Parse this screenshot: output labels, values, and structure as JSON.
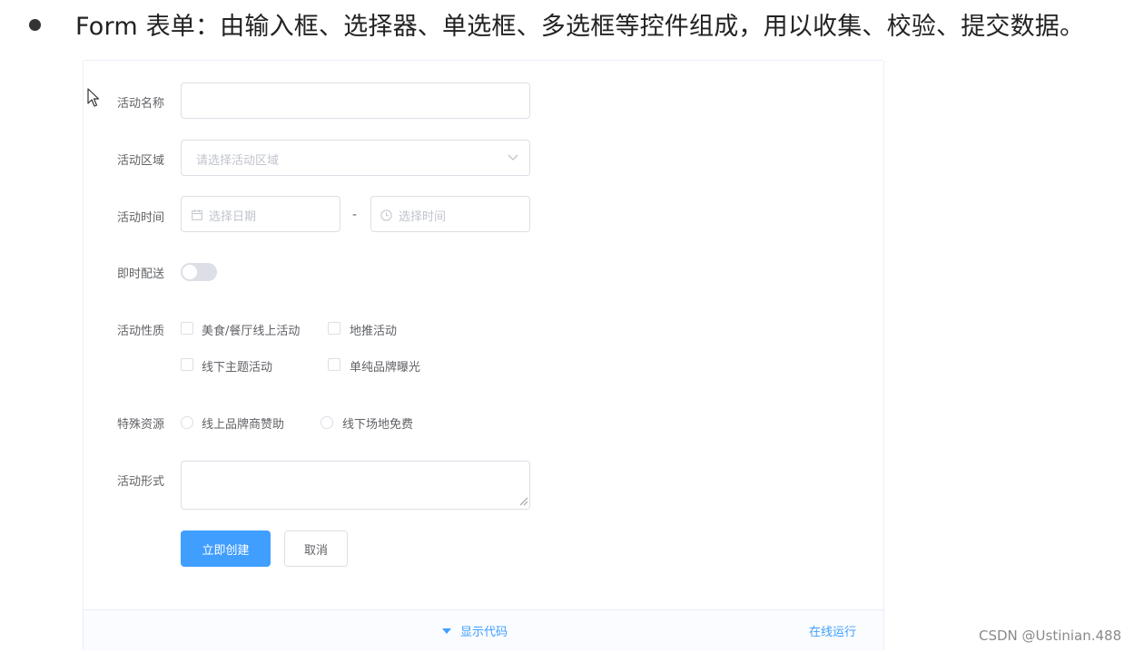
{
  "heading": {
    "text": "Form 表单：由输入框、选择器、单选框、多选框等控件组成，用以收集、校验、提交数据。"
  },
  "form": {
    "name": {
      "label": "活动名称",
      "value": ""
    },
    "region": {
      "label": "活动区域",
      "placeholder": "请选择活动区域"
    },
    "time": {
      "label": "活动时间",
      "date_placeholder": "选择日期",
      "separator": "-",
      "time_placeholder": "选择时间"
    },
    "delivery": {
      "label": "即时配送",
      "on": false
    },
    "type": {
      "label": "活动性质",
      "options": [
        "美食/餐厅线上活动",
        "地推活动",
        "线下主题活动",
        "单纯品牌曝光"
      ]
    },
    "resource": {
      "label": "特殊资源",
      "options": [
        "线上品牌商赞助",
        "线下场地免费"
      ]
    },
    "desc": {
      "label": "活动形式",
      "value": ""
    },
    "submit_label": "立即创建",
    "cancel_label": "取消"
  },
  "footer": {
    "show_code": "显示代码",
    "run_online": "在线运行"
  },
  "watermark": "CSDN @Ustinian.488",
  "colors": {
    "primary": "#409eff",
    "border": "#dcdfe6",
    "placeholder": "#c0c4cc",
    "text": "#606266"
  }
}
